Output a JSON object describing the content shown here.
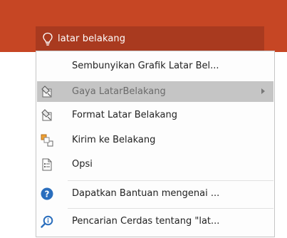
{
  "search": {
    "value": "latar belakang"
  },
  "menu": {
    "items": [
      {
        "label": "Sembunyikan Grafik Latar Bel...",
        "icon": "none"
      },
      {
        "label": "Gaya LatarBelakang",
        "icon": "background-style-icon",
        "has_submenu": true,
        "state": "hovered-disabled"
      },
      {
        "label": "Format Latar Belakang",
        "icon": "format-background-icon"
      },
      {
        "label": "Kirim ke Belakang",
        "icon": "send-to-back-icon"
      },
      {
        "label": "Opsi",
        "icon": "options-icon"
      },
      {
        "label": "Dapatkan Bantuan mengenai ...",
        "icon": "help-icon"
      },
      {
        "label": "Pencarian Cerdas tentang \"lat...",
        "icon": "smart-lookup-icon"
      }
    ]
  },
  "colors": {
    "ribbon": "#c64624",
    "search_box": "#a93a1f",
    "highlight": "#c5c5c5",
    "help_blue": "#2a6ebd"
  }
}
